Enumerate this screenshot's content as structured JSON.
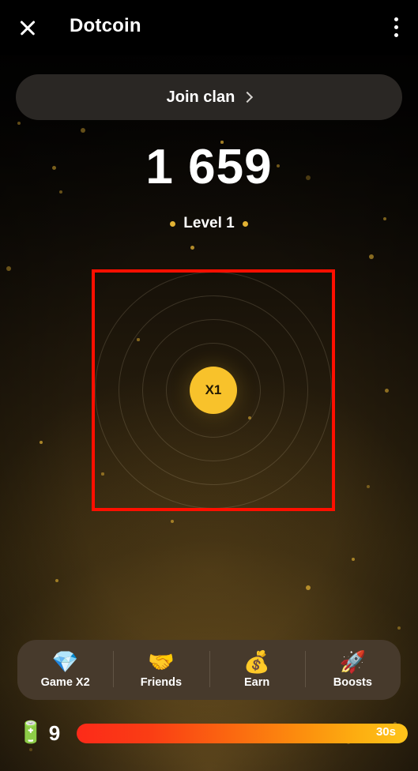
{
  "header": {
    "title": "Dotcoin",
    "close_icon": "close-icon",
    "menu_icon": "kebab-menu-icon"
  },
  "clan": {
    "label": "Join clan",
    "chevron_icon": "chevron-right-icon"
  },
  "stats": {
    "score": "1 659",
    "level": "Level 1"
  },
  "tap_zone": {
    "multiplier": "X1",
    "ring_count": 4,
    "annotation_color": "#ff0f00"
  },
  "bottom_nav": {
    "items": [
      {
        "label": "Game X2",
        "icon": "💎",
        "icon_name": "diamond-icon"
      },
      {
        "label": "Friends",
        "icon": "🤝",
        "icon_name": "handshake-icon"
      },
      {
        "label": "Earn",
        "icon": "💰",
        "icon_name": "money-bag-icon"
      },
      {
        "label": "Boosts",
        "icon": "🚀",
        "icon_name": "rocket-icon"
      }
    ]
  },
  "energy": {
    "battery_icon": "🔋",
    "count": "9",
    "time_remaining": "30s"
  },
  "colors": {
    "coin": "#f8c22b",
    "nav_bar": "#473a2c",
    "join_clan": "#2a2724",
    "energy_start": "#fc2a19",
    "energy_end": "#fec41b",
    "particle": "#d8a932"
  }
}
